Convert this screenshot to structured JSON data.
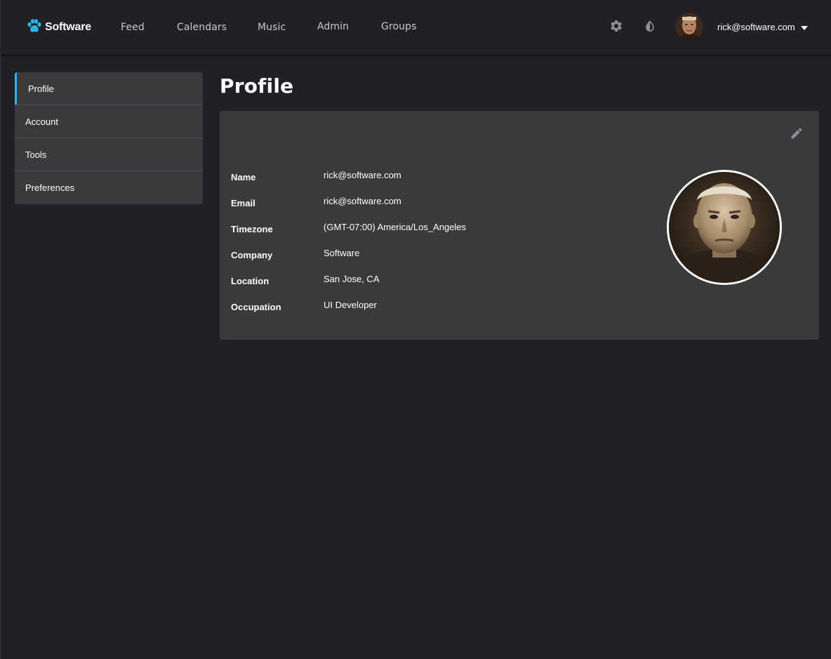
{
  "brand": {
    "name": "Software",
    "logo_icon": "paw-icon",
    "accent": "#2cb5e8"
  },
  "nav": {
    "links": [
      {
        "label": "Feed"
      },
      {
        "label": "Calendars"
      },
      {
        "label": "Music"
      },
      {
        "label": "Admin"
      },
      {
        "label": "Groups"
      }
    ],
    "settings_icon": "gear-icon",
    "theme_icon": "contrast-icon",
    "user_email": "rick@software.com",
    "user_menu_icon": "caret-down-icon"
  },
  "sidebar": {
    "items": [
      {
        "label": "Profile",
        "active": true
      },
      {
        "label": "Account",
        "active": false
      },
      {
        "label": "Tools",
        "active": false
      },
      {
        "label": "Preferences",
        "active": false
      }
    ]
  },
  "page": {
    "title": "Profile"
  },
  "profile": {
    "edit_icon": "pencil-icon",
    "fields": [
      {
        "label": "Name",
        "value": "rick@software.com"
      },
      {
        "label": "Email",
        "value": "rick@software.com"
      },
      {
        "label": "Timezone",
        "value": "(GMT-07:00) America/Los_Angeles"
      },
      {
        "label": "Company",
        "value": "Software"
      },
      {
        "label": "Location",
        "value": "San Jose, CA"
      },
      {
        "label": "Occupation",
        "value": "UI Developer"
      }
    ]
  }
}
